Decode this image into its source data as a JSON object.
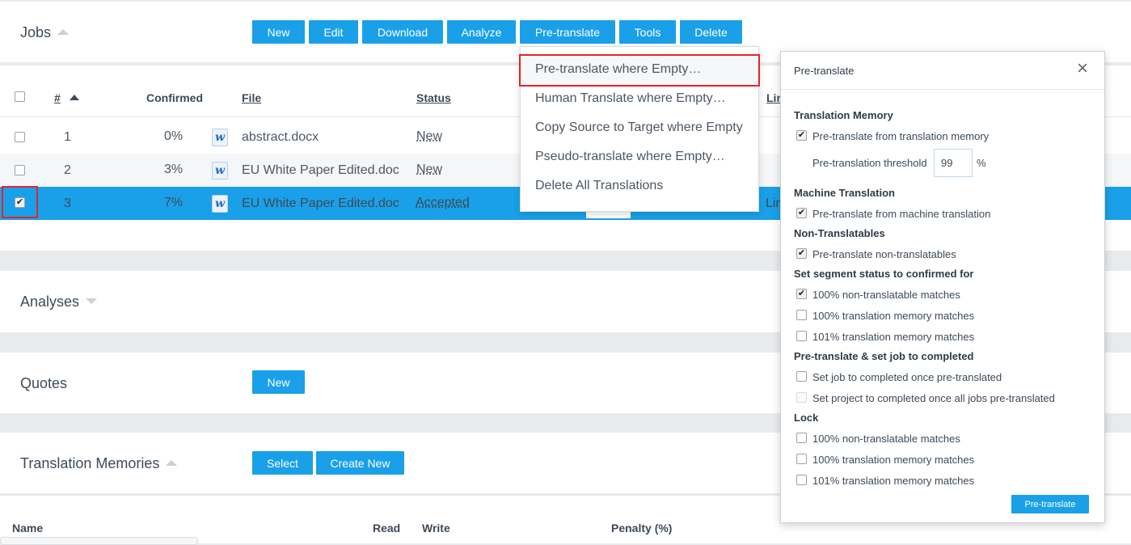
{
  "jobs": {
    "title": "Jobs",
    "toolbar": {
      "new": "New",
      "edit": "Edit",
      "download": "Download",
      "analyze": "Analyze",
      "pretranslate": "Pre-translate",
      "tools": "Tools",
      "delete": "Delete"
    },
    "columns": {
      "num": "#",
      "confirmed": "Confirmed",
      "file": "File",
      "status": "Status",
      "lin": "Lin"
    },
    "rows": [
      {
        "num": "1",
        "confirmed": "0%",
        "file": "abstract.docx",
        "status": "New",
        "selected": false
      },
      {
        "num": "2",
        "confirmed": "3%",
        "file": "EU White Paper Edited.doc",
        "status": "New",
        "selected": false
      },
      {
        "num": "3",
        "confirmed": "7%",
        "file": "EU White Paper Edited.doc",
        "status": "Accepted",
        "selected": true,
        "extra": "Lin"
      }
    ]
  },
  "pretranslate_menu": {
    "items": [
      "Pre-translate where Empty…",
      "Human Translate where Empty…",
      "Copy Source to Target where Empty",
      "Pseudo-translate where Empty…",
      "Delete All Translations"
    ]
  },
  "analyses": {
    "title": "Analyses"
  },
  "quotes": {
    "title": "Quotes",
    "new": "New"
  },
  "tm": {
    "title": "Translation Memories",
    "select": "Select",
    "create": "Create New",
    "columns": {
      "name": "Name",
      "read": "Read",
      "write": "Write",
      "penalty": "Penalty (%)"
    }
  },
  "dialog": {
    "title": "Pre-translate",
    "close": "×",
    "tm_section": "Translation Memory",
    "tm_option": "Pre-translate from translation memory",
    "threshold_label": "Pre-translation threshold",
    "threshold_value": "99",
    "threshold_unit": "%",
    "mt_section": "Machine Translation",
    "mt_option": "Pre-translate from machine translation",
    "nt_section": "Non-Translatables",
    "nt_option": "Pre-translate non-translatables",
    "status_section": "Set segment status to confirmed for",
    "status_opt1": "100% non-translatable matches",
    "status_opt2": "100% translation memory matches",
    "status_opt3": "101% translation memory matches",
    "complete_section": "Pre-translate & set job to completed",
    "complete_opt1": "Set job to completed once pre-translated",
    "complete_opt2": "Set project to completed once all jobs pre-translated",
    "lock_section": "Lock",
    "lock_opt1": "100% non-translatable matches",
    "lock_opt2": "100% translation memory matches",
    "lock_opt3": "101% translation memory matches",
    "submit": "Pre-translate"
  },
  "colors": {
    "accent": "#1aa0e8",
    "highlight_border": "#e0262c",
    "selected_row": "#1aa0e8"
  }
}
